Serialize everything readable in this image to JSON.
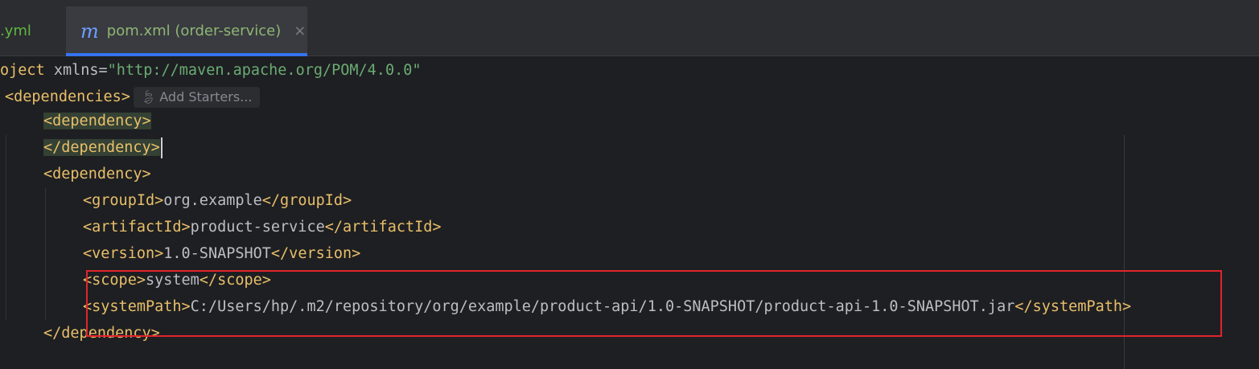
{
  "tabs": [
    {
      "label": ".yml"
    },
    {
      "icon": "m",
      "label": "pom.xml (order-service)",
      "close": "×"
    }
  ],
  "editor": {
    "line1": {
      "tag_open": "oject",
      "attr": " xmlns=",
      "value": "\"http://maven.apache.org/POM/4.0.0\""
    },
    "line2": {
      "tag": "<dependencies>",
      "hint": "Add Starters..."
    },
    "line3": {
      "tag": "<dependency>"
    },
    "line4": {
      "tag": "</dependency>"
    },
    "line5": {
      "tag": "<dependency>"
    },
    "line6": {
      "open": "<groupId>",
      "text": "org.example",
      "close": "</groupId>"
    },
    "line7": {
      "open": "<artifactId>",
      "text": "product-service",
      "close": "</artifactId>"
    },
    "line8": {
      "open": "<version>",
      "text": "1.0-SNAPSHOT",
      "close": "</version>"
    },
    "line9": {
      "open": "<scope>",
      "text": "system",
      "close": "</scope>"
    },
    "line10": {
      "open": "<systemPath>",
      "text": "C:/Users/hp/.m2/repository/org/example/product-api/1.0-SNAPSHOT/product-api-1.0-SNAPSHOT.jar",
      "close": "</systemPath>"
    },
    "line11": {
      "tag": "</dependency>"
    }
  },
  "colors": {
    "tag": "#e8bf6a",
    "string": "#6aab73",
    "highlight_box": "#e0242b",
    "accent": "#3574f0"
  }
}
